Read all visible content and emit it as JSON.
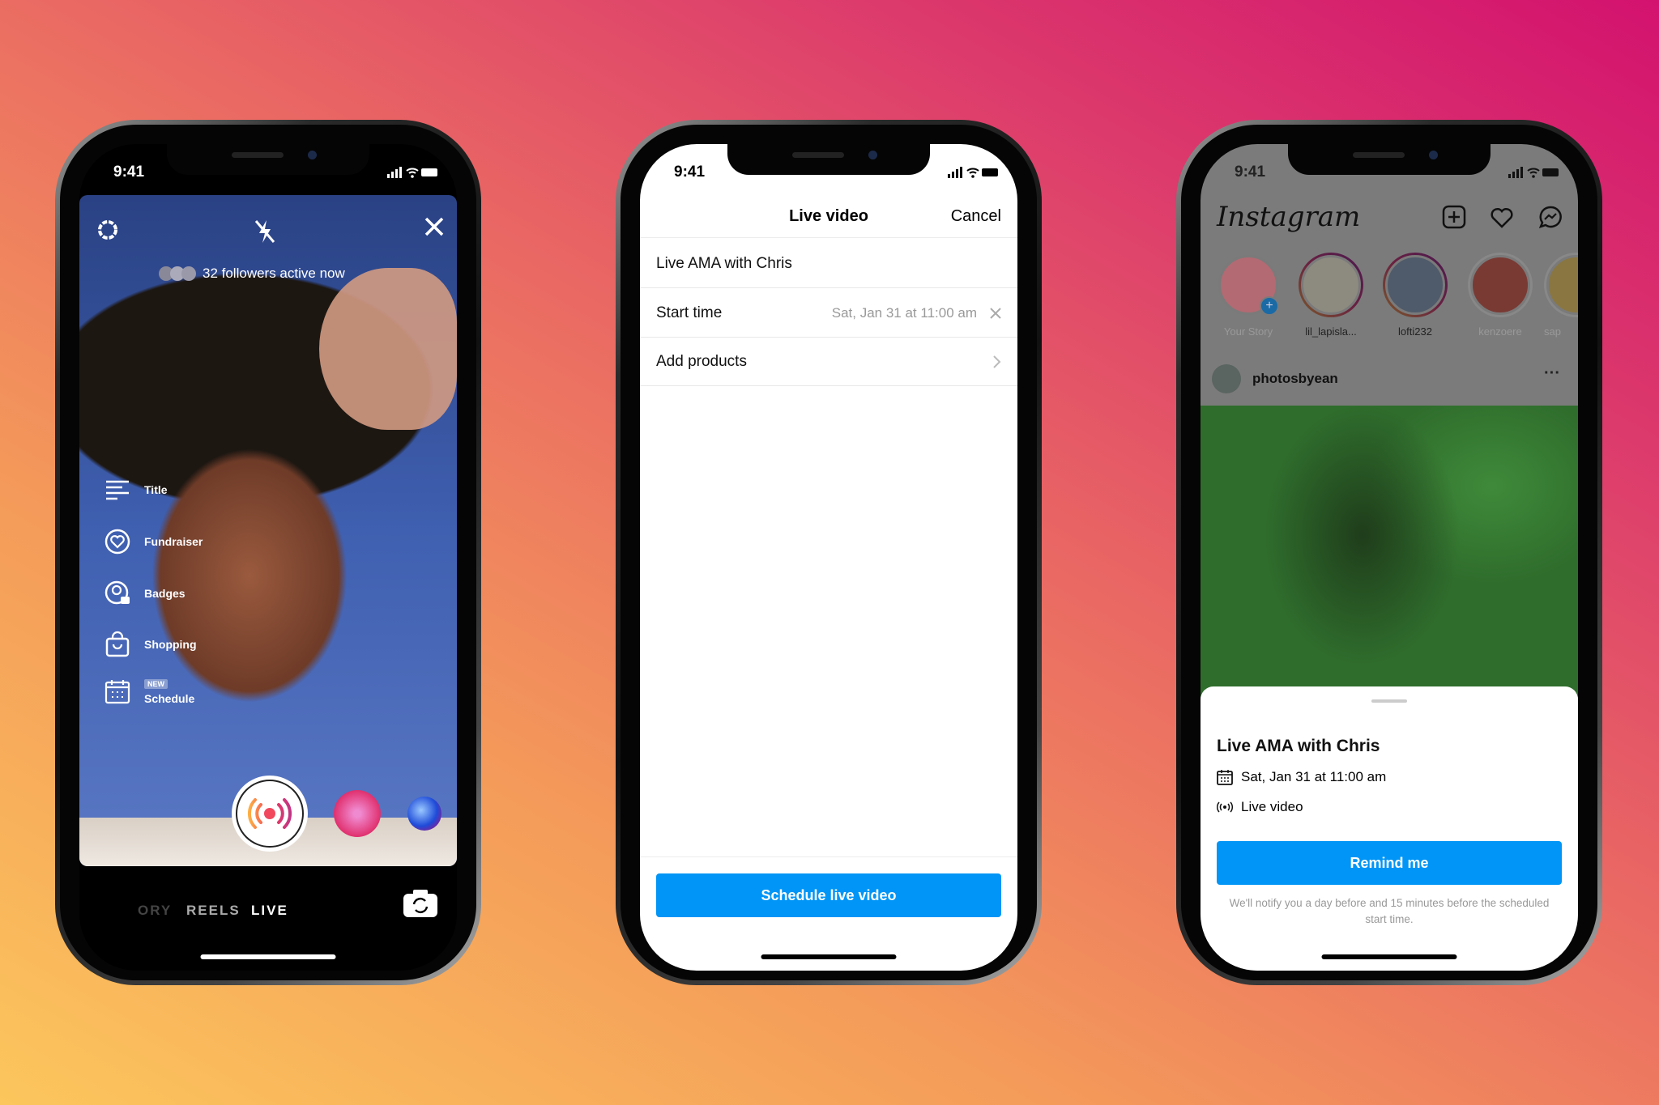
{
  "status_time": "9:41",
  "phone1": {
    "followers_text": "32 followers active now",
    "menu": [
      {
        "label": "Title",
        "icon": "title-lines-icon"
      },
      {
        "label": "Fundraiser",
        "icon": "heart-circle-icon"
      },
      {
        "label": "Badges",
        "icon": "badge-icon"
      },
      {
        "label": "Shopping",
        "icon": "shopping-bag-icon"
      },
      {
        "label": "Schedule",
        "icon": "calendar-icon",
        "badge": "NEW"
      }
    ],
    "modes": [
      "ORY",
      "REELS",
      "LIVE"
    ],
    "active_mode": "LIVE"
  },
  "phone2": {
    "title": "Live video",
    "cancel": "Cancel",
    "title_value": "Live AMA with Chris",
    "start_time_label": "Start time",
    "start_time_value": "Sat, Jan 31 at 11:00 am",
    "add_products": "Add products",
    "schedule_button": "Schedule live video"
  },
  "phone3": {
    "logo": "Instagram",
    "stories": [
      "Your Story",
      "lil_lapisla...",
      "lofti232",
      "kenzoere",
      "sap"
    ],
    "post_user": "photosbyean",
    "sheet": {
      "title": "Live AMA with Chris",
      "date": "Sat, Jan 31 at 11:00 am",
      "type": "Live video",
      "button": "Remind me",
      "note": "We'll notify you a day before and 15 minutes before the scheduled start time."
    }
  },
  "colors": {
    "accent": "#0095f6",
    "post_image": "#2f6d2c"
  }
}
